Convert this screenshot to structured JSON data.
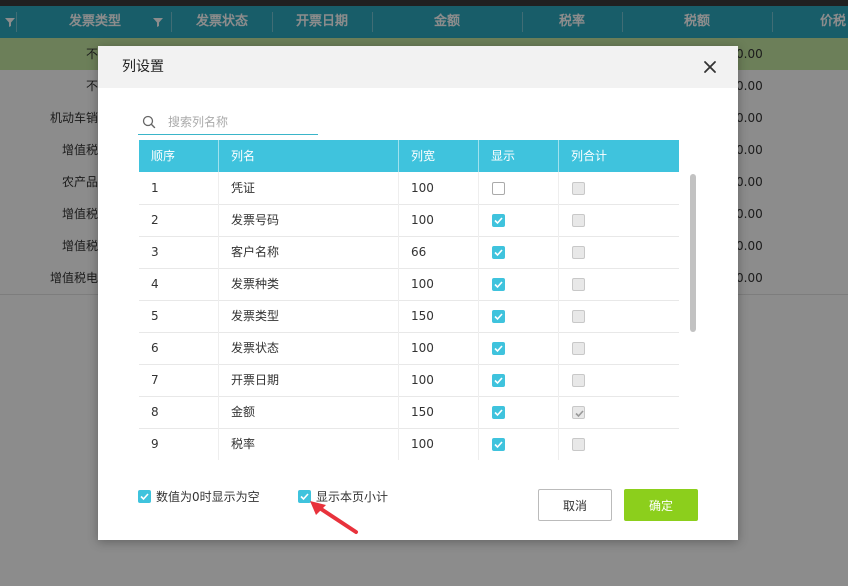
{
  "background": {
    "headers": [
      "发票类型",
      "发票状态",
      "开票日期",
      "金额",
      "税率",
      "税额",
      "价税"
    ],
    "rows": [
      {
        "type": "不开",
        "amount": "0.00"
      },
      {
        "type": "不开",
        "amount": "0.00"
      },
      {
        "type": "机动车销售",
        "amount": "0.00"
      },
      {
        "type": "增值税专",
        "amount": "0.00"
      },
      {
        "type": "农产品收",
        "amount": "0.00"
      },
      {
        "type": "增值税普",
        "amount": "0.00"
      },
      {
        "type": "增值税普",
        "amount": "0.00"
      },
      {
        "type": "增值税电子",
        "amount": "0.00"
      }
    ]
  },
  "dialog": {
    "title": "列设置",
    "close_icon": "close-icon",
    "search": {
      "placeholder": "搜索列名称"
    },
    "columns": [
      "顺序",
      "列名",
      "列宽",
      "显示",
      "列合计"
    ],
    "rows": [
      {
        "order": "1",
        "name": "凭证",
        "width": "100",
        "show": false,
        "sum": "disabled"
      },
      {
        "order": "2",
        "name": "发票号码",
        "width": "100",
        "show": true,
        "sum": "disabled"
      },
      {
        "order": "3",
        "name": "客户名称",
        "width": "66",
        "show": true,
        "sum": "disabled"
      },
      {
        "order": "4",
        "name": "发票种类",
        "width": "100",
        "show": true,
        "sum": "disabled"
      },
      {
        "order": "5",
        "name": "发票类型",
        "width": "150",
        "show": true,
        "sum": "disabled"
      },
      {
        "order": "6",
        "name": "发票状态",
        "width": "100",
        "show": true,
        "sum": "disabled"
      },
      {
        "order": "7",
        "name": "开票日期",
        "width": "100",
        "show": true,
        "sum": "disabled"
      },
      {
        "order": "8",
        "name": "金额",
        "width": "150",
        "show": true,
        "sum": "disabled-checked"
      },
      {
        "order": "9",
        "name": "税率",
        "width": "100",
        "show": true,
        "sum": "disabled"
      }
    ],
    "options": {
      "zero_as_empty": {
        "label": "数值为0时显示为空",
        "checked": true
      },
      "page_subtotal": {
        "label": "显示本页小计",
        "checked": true
      }
    },
    "buttons": {
      "cancel": "取消",
      "ok": "确定"
    }
  },
  "colors": {
    "accent": "#3fc3dd",
    "header_bg": "#2ca9c0",
    "ok_button": "#8ccf1c",
    "selected_row": "#c5e8a3",
    "annotation_arrow": "#e8323c"
  }
}
